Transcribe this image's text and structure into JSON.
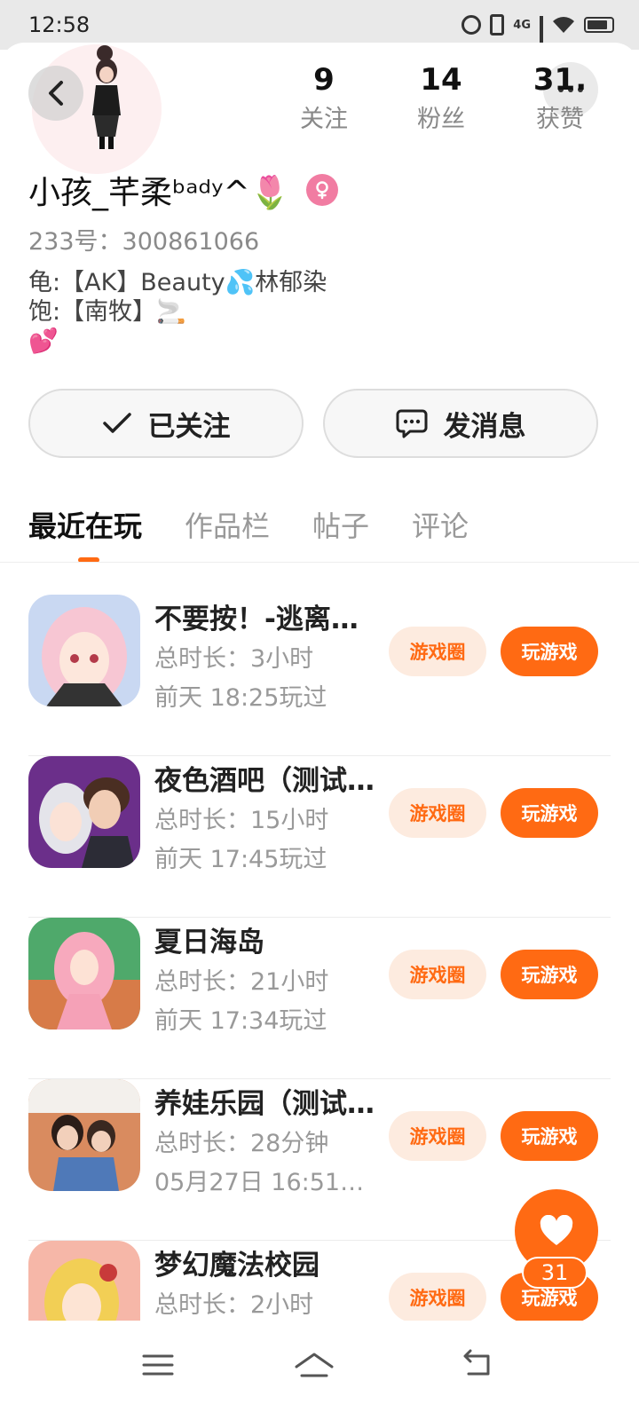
{
  "status_bar": {
    "time": "12:58",
    "network": "4G"
  },
  "profile": {
    "stats": [
      {
        "value": "9",
        "label": "关注"
      },
      {
        "value": "14",
        "label": "粉丝"
      },
      {
        "value": "31.",
        "label": "获赞"
      }
    ],
    "username": "小孩_芊柔ᵇᵃᵈʸ^🌷",
    "uid": "233号：300861066",
    "bio": "龟:【AK】Beauty💦林郁染\n饱:【南牧】🚬\n💕",
    "follow_label": "已关注",
    "message_label": "发消息"
  },
  "tabs": [
    {
      "label": "最近在玩",
      "active": true
    },
    {
      "label": "作品栏",
      "active": false
    },
    {
      "label": "帖子",
      "active": false
    },
    {
      "label": "评论",
      "active": false
    }
  ],
  "games": [
    {
      "name": "不要按！-逃离…",
      "duration": "总时长：3小时",
      "last_played": "前天  18:25玩过"
    },
    {
      "name": "夜色酒吧（测试…",
      "duration": "总时长：15小时",
      "last_played": "前天  17:45玩过"
    },
    {
      "name": "夏日海岛",
      "duration": "总时长：21小时",
      "last_played": "前天  17:34玩过"
    },
    {
      "name": "养娃乐园（测试…",
      "duration": "总时长：28分钟",
      "last_played": "05月27日  16:51…"
    },
    {
      "name": "梦幻魔法校园",
      "duration": "总时长：2小时",
      "last_played": ""
    }
  ],
  "game_buttons": {
    "circle_label": "游戏圈",
    "play_label": "玩游戏"
  },
  "like": {
    "count": "31"
  },
  "colors": {
    "accent": "#ff6a13",
    "accent_light": "#fdebdf",
    "gender_pink": "#f17ca2"
  }
}
